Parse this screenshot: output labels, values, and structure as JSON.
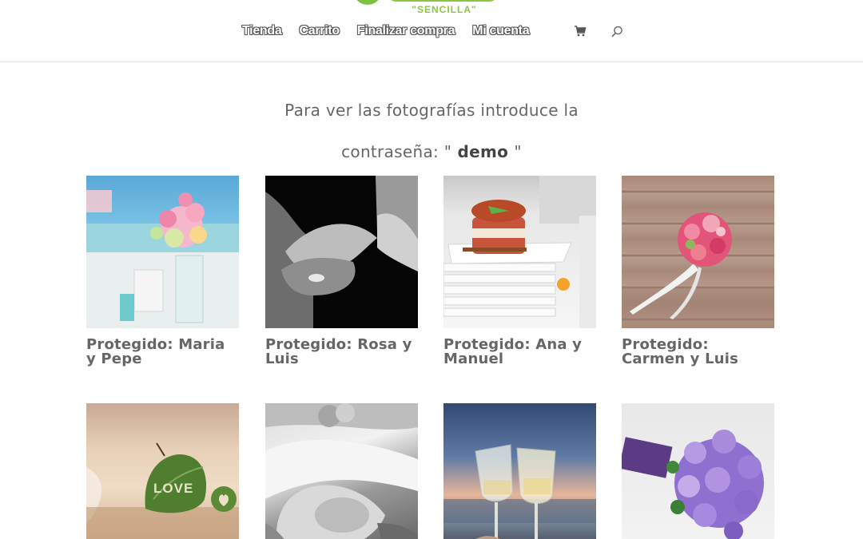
{
  "brand": {
    "logo_text": "\"SENCILLA\""
  },
  "nav": {
    "items": [
      {
        "label": "Tienda"
      },
      {
        "label": "Carrito"
      },
      {
        "label": "Finalizar compra"
      },
      {
        "label": "Mi cuenta"
      }
    ],
    "cart_icon": "shopping-cart-icon",
    "search_icon": "search-icon"
  },
  "intro": {
    "line1": "Para ver las fotografías introduce la",
    "line2_prefix": "contraseña: \"",
    "password": " demo ",
    "line2_suffix": "\""
  },
  "galleries": [
    {
      "title": "Protegido: Maria y Pepe"
    },
    {
      "title": "Protegido: Rosa y Luis"
    },
    {
      "title": "Protegido: Ana y Manuel"
    },
    {
      "title": "Protegido: Carmen y Luis"
    },
    {
      "title": ""
    },
    {
      "title": ""
    },
    {
      "title": ""
    },
    {
      "title": ""
    }
  ],
  "colors": {
    "text": "#666666",
    "logo_green": "#8cc63f",
    "divider": "#e8e8e8"
  }
}
